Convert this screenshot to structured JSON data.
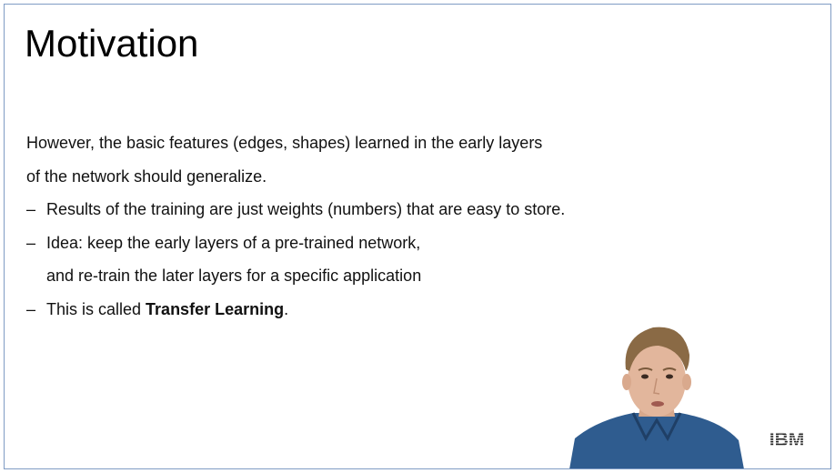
{
  "slide": {
    "title": "Motivation",
    "paragraph_line1": "However, the basic features (edges, shapes) learned in the early layers",
    "paragraph_line2": "of the network should generalize.",
    "bullet_symbol": "–",
    "bullets": [
      {
        "text": "Results of the training are just weights (numbers) that are easy to store."
      },
      {
        "line1": "Idea: keep the early layers of a pre-trained network,",
        "line2": "and re-train the later layers for a specific application"
      },
      {
        "before": "This is called ",
        "bold": "Transfer Learning",
        "after": "."
      }
    ]
  },
  "logo": {
    "text": "IBM",
    "color": "#1f1f1f"
  },
  "colors": {
    "frame_border": "#7f9bc4",
    "shirt": "#2f5c8f",
    "skin": "#e2b69c",
    "hair": "#8a6a45"
  }
}
